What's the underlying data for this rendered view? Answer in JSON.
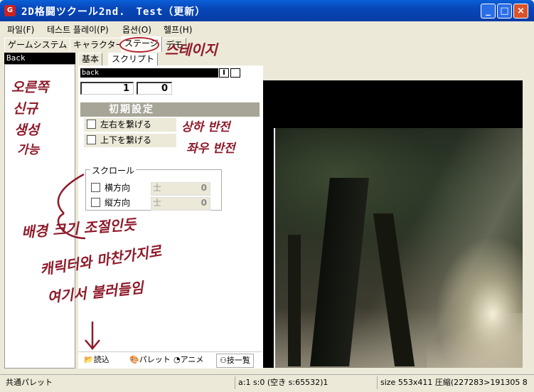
{
  "window": {
    "title": "2D格闘ツクール2nd.　Test（更新）",
    "icon": "app-icon"
  },
  "menu": [
    "파일(F)",
    "테스트 플레이(P)",
    "옵션(O)",
    "헬프(H)"
  ],
  "tabs": [
    "ゲームシステム",
    "キャラクター",
    "ステージ",
    "デモ"
  ],
  "active_tab": "ステージ",
  "left_header": "Back",
  "subtabs": [
    "基本",
    "スクリプト"
  ],
  "name_field": "back",
  "i_marker": "I",
  "numbers": [
    "1",
    "0"
  ],
  "section_title": "初期設定",
  "checkboxes": [
    "左右を繋げる",
    "上下を繋げる"
  ],
  "scroll": {
    "legend": "スクロール",
    "rows": [
      {
        "label": "横方向",
        "sign": "士",
        "value": "0"
      },
      {
        "label": "縦方向",
        "sign": "士",
        "value": "0"
      }
    ]
  },
  "bottom_buttons": [
    "読込",
    "パレット",
    "アニメ",
    "技一覧"
  ],
  "status": {
    "left": "共通パレット",
    "middle": "a:1 s:0 (空き s:65532)1",
    "right": "size 553x411 圧縮(227283>191305 8"
  },
  "annotations": {
    "tab": "스테이지",
    "left_panel": [
      "오른쪽",
      "신규",
      "생성",
      "가능"
    ],
    "checkbox_note": [
      "상하 반전",
      "좌우 반전"
    ],
    "scroll_note": "배경 크기 조절인듯",
    "bottom_note": [
      "캐릭터와 마찬가지로",
      "여기서 불러들임"
    ]
  },
  "colors": {
    "titlebar": "#0a5fd8",
    "annotation_ink": "#8e1a2a",
    "section_bg": "#a7a597"
  }
}
